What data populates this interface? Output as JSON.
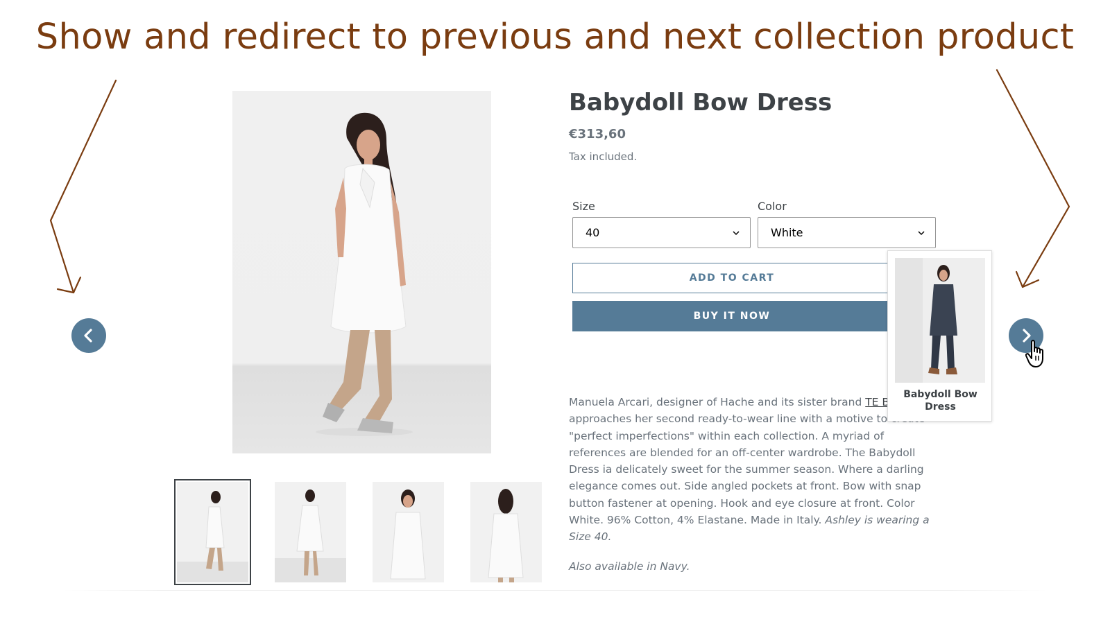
{
  "banner": {
    "text": "Show and redirect to previous and next collection product"
  },
  "navigation": {
    "prev_icon": "chevron-left-icon",
    "next_icon": "chevron-right-icon",
    "button_color": "#557b97"
  },
  "product": {
    "title": "Babydoll Bow Dress",
    "price": "€313,60",
    "tax_note": "Tax included.",
    "size_label": "Size",
    "size_value": "40",
    "color_label": "Color",
    "color_value": "White",
    "add_to_cart": "ADD TO CART",
    "buy_now": "BUY IT NOW",
    "description_intro": "Manuela Arcari, designer of Hache and its sister brand ",
    "brand_link": "TE BANTINE",
    "description_body": ", approaches her second ready-to-wear line with a motive to create \"perfect imperfections\" within each collection. A myriad of references are blended for an off-center wardrobe. The Babydoll Dress ia delicately sweet for the summer season. Where a darling elegance comes out. Side angled pockets at front. Bow with snap button fastener at opening. Hook and eye closure at front. Color White. 96% Cotton, 4% Elastane. Made in Italy. ",
    "model_note": "Ashley is wearing a Size 40.",
    "also_available": "Also available in Navy."
  },
  "next_product_popup": {
    "name_line1": "Babydoll Bow",
    "name_line2": "Dress"
  },
  "thumbnails": [
    "thumbnail-1",
    "thumbnail-2",
    "thumbnail-3",
    "thumbnail-4"
  ],
  "colors": {
    "accent": "#557b97",
    "annotation": "#7a3c10",
    "text_dark": "#3d4246",
    "text_muted": "#69727b"
  }
}
